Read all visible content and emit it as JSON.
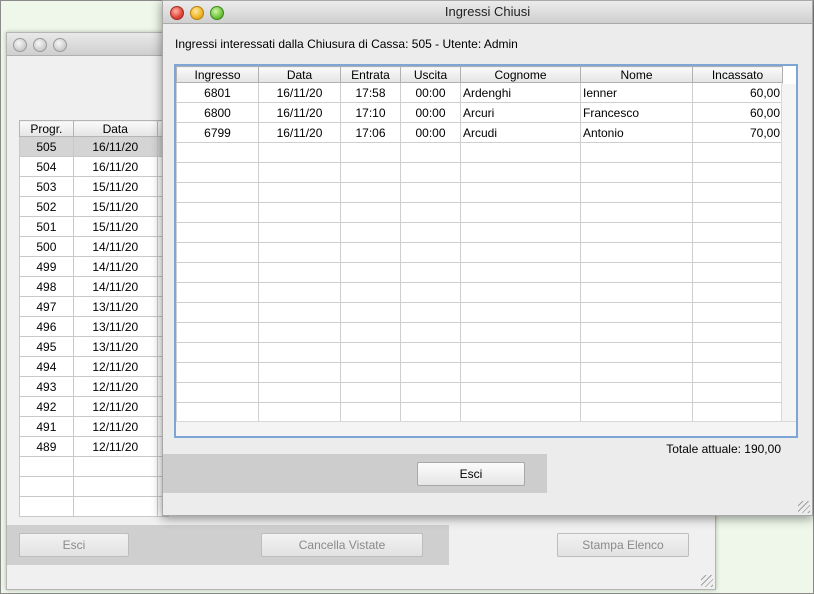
{
  "background_window": {
    "columns": [
      "Progr.",
      "Data"
    ],
    "rows": [
      [
        "505",
        "16/11/20"
      ],
      [
        "504",
        "16/11/20"
      ],
      [
        "503",
        "15/11/20"
      ],
      [
        "502",
        "15/11/20"
      ],
      [
        "501",
        "15/11/20"
      ],
      [
        "500",
        "14/11/20"
      ],
      [
        "499",
        "14/11/20"
      ],
      [
        "498",
        "14/11/20"
      ],
      [
        "497",
        "13/11/20"
      ],
      [
        "496",
        "13/11/20"
      ],
      [
        "495",
        "13/11/20"
      ],
      [
        "494",
        "12/11/20"
      ],
      [
        "493",
        "12/11/20"
      ],
      [
        "492",
        "12/11/20"
      ],
      [
        "491",
        "12/11/20"
      ],
      [
        "489",
        "12/11/20"
      ]
    ],
    "buttons": {
      "esci": "Esci",
      "cancella_vistate": "Cancella Vistate",
      "stampa_elenco": "Stampa Elenco"
    }
  },
  "dialog": {
    "title": "Ingressi Chiusi",
    "subtitle": "Ingressi interessati dalla Chiusura di Cassa: 505 - Utente: Admin",
    "columns": [
      "Ingresso",
      "Data",
      "Entrata",
      "Uscita",
      "Cognome",
      "Nome",
      "Incassato"
    ],
    "rows": [
      [
        "6801",
        "16/11/20",
        "17:58",
        "00:00",
        "Ardenghi",
        "Ienner",
        "60,00"
      ],
      [
        "6800",
        "16/11/20",
        "17:10",
        "00:00",
        "Arcuri",
        "Francesco",
        "60,00"
      ],
      [
        "6799",
        "16/11/20",
        "17:06",
        "00:00",
        "Arcudi",
        "Antonio",
        "70,00"
      ]
    ],
    "totale": "Totale attuale: 190,00",
    "esci_label": "Esci"
  }
}
